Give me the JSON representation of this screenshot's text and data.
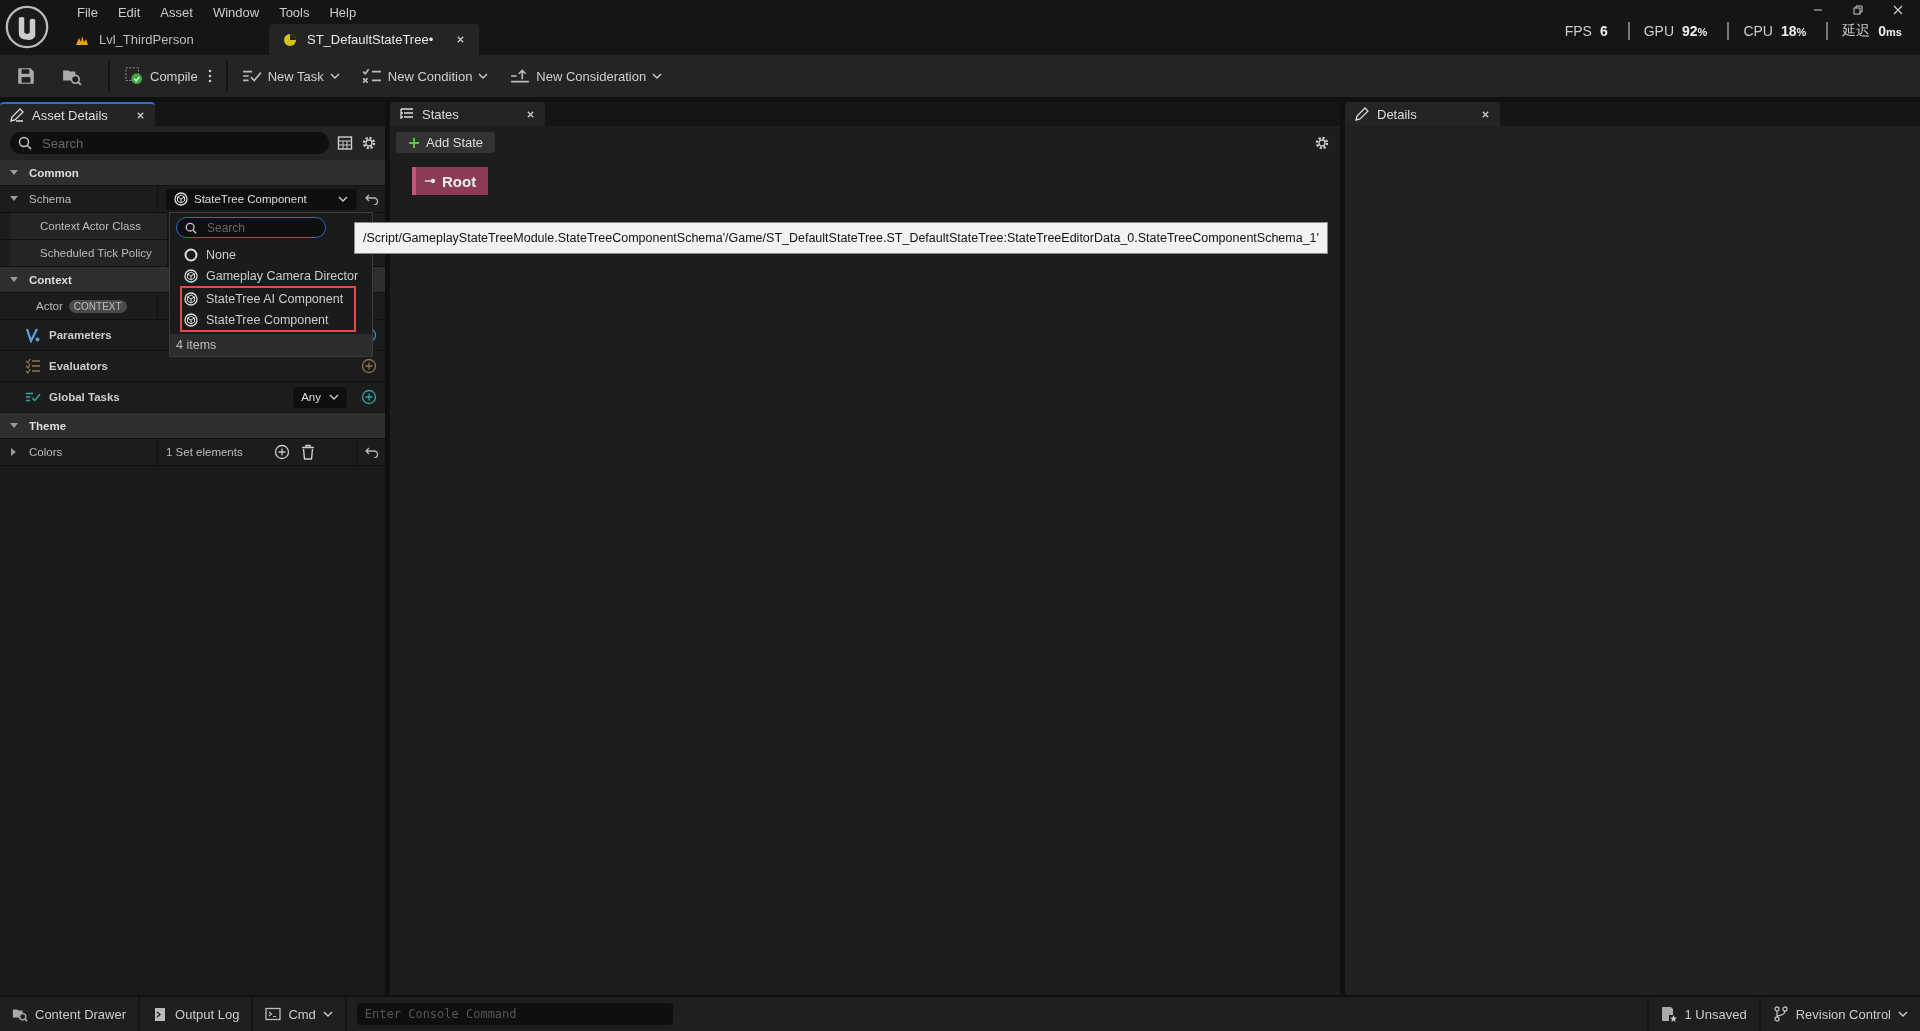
{
  "menu": [
    "File",
    "Edit",
    "Asset",
    "Window",
    "Tools",
    "Help"
  ],
  "doc_tabs": [
    {
      "label": "Lvl_ThirdPerson",
      "kind": "level",
      "selected": false
    },
    {
      "label": "ST_DefaultStateTree•",
      "kind": "statetree",
      "selected": true
    }
  ],
  "stats": [
    {
      "label": "FPS",
      "value": "6"
    },
    {
      "label": "GPU",
      "value": "92",
      "unit": "%"
    },
    {
      "label": "CPU",
      "value": "18",
      "unit": "%"
    },
    {
      "label": "延迟",
      "value": "0",
      "unit": "ms"
    }
  ],
  "toolbar": {
    "compile": "Compile",
    "buttons": [
      {
        "label": "New Task",
        "kind": "task"
      },
      {
        "label": "New Condition",
        "kind": "condition"
      },
      {
        "label": "New Consideration",
        "kind": "consideration"
      }
    ]
  },
  "asset_details": {
    "tab": "Asset Details",
    "search": {
      "placeholder": "Search"
    },
    "rows": [
      {
        "kind": "category",
        "label": "Common",
        "expanded": true
      },
      {
        "kind": "property",
        "label": "Schema",
        "expanded": true,
        "value": "StateTree Component"
      },
      {
        "kind": "subproperty",
        "label": "Context Actor Class"
      },
      {
        "kind": "subproperty",
        "label": "Scheduled Tick Policy"
      },
      {
        "kind": "category",
        "label": "Context",
        "expanded": true
      },
      {
        "kind": "badge",
        "label": "Actor",
        "badge": "CONTEXT"
      },
      {
        "kind": "parameters",
        "label": "Parameters"
      },
      {
        "kind": "evaluators",
        "label": "Evaluators"
      },
      {
        "kind": "tasks",
        "label": "Global Tasks",
        "mode": "Any"
      },
      {
        "kind": "category",
        "label": "Theme",
        "expanded": true
      },
      {
        "kind": "set",
        "label": "Colors",
        "expanded": false,
        "value": "1 Set elements"
      }
    ]
  },
  "schema_popup": {
    "search": {
      "placeholder": "Search"
    },
    "options": [
      {
        "label": "None",
        "kind": "none",
        "highlighted": false
      },
      {
        "label": "Gameplay Camera Director",
        "kind": "class",
        "highlighted": false
      },
      {
        "label": "StateTree AI Component",
        "kind": "class",
        "highlighted": true
      },
      {
        "label": "StateTree Component",
        "kind": "class",
        "highlighted": true
      }
    ],
    "count": "4 items"
  },
  "tooltip": "/Script/GameplayStateTreeModule.StateTreeComponentSchema'/Game/ST_DefaultStateTree.ST_DefaultStateTree:StateTreeEditorData_0.StateTreeComponentSchema_1'",
  "states_panel": {
    "tab": "States",
    "add_button": "Add State",
    "nodes": [
      {
        "label": "Root",
        "color": "#8c3a58"
      }
    ]
  },
  "details_panel": {
    "tab": "Details"
  },
  "status_bar": {
    "left": [
      {
        "label": "Content Drawer",
        "kind": "drawer"
      },
      {
        "label": "Output Log",
        "kind": "log"
      }
    ],
    "cmd": "Cmd",
    "console": {
      "placeholder": "Enter Console Command"
    },
    "unsaved": "1 Unsaved",
    "revision": "Revision Control"
  }
}
